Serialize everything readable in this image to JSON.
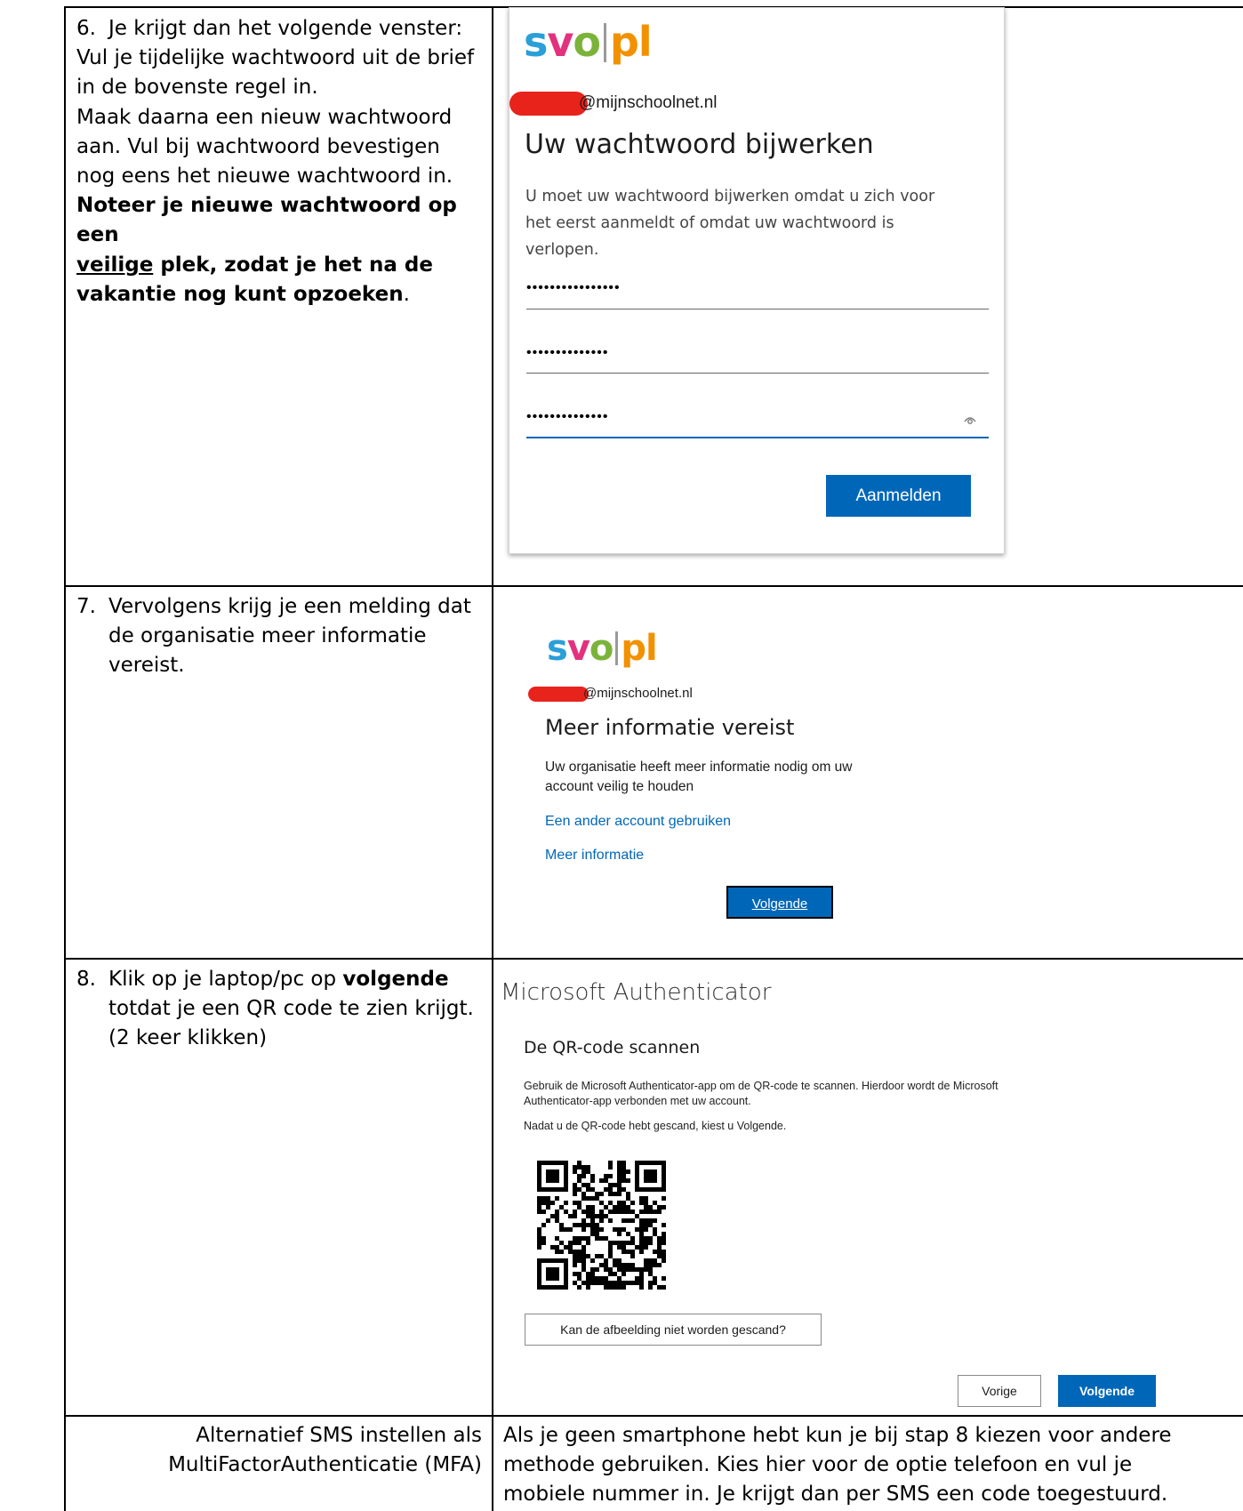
{
  "rows": {
    "step6": {
      "number": "6.",
      "lines": [
        "Je krijgt dan het volgende venster:",
        "Vul je tijdelijke wachtwoord uit de brief",
        "in de bovenste regel in.",
        "Maak daarna een nieuw wachtwoord",
        "aan. Vul bij wachtwoord bevestigen",
        "nog eens het nieuwe wachtwoord in."
      ],
      "bold_1": "Noteer je nieuwe wachtwoord op een",
      "bold_2_underlined": "veilige",
      "bold_2_rest": " plek, zodat je het na de",
      "bold_3": "vakantie nog kunt opzoeken",
      "bold_3_tail": "."
    },
    "step7": {
      "number": "7.",
      "lines": [
        "Vervolgens krijg je een melding dat",
        "de organisatie meer informatie",
        "vereist."
      ]
    },
    "step8": {
      "number": "8.",
      "line1_prefix": "Klik op je laptop/pc op ",
      "line1_bold": "volgende",
      "line2": "totdat je een QR code te zien krijgt.",
      "line3": "(2 keer klikken)"
    },
    "sms": {
      "left_line1": "Alternatief SMS instellen als",
      "left_line2": "MultiFactorAuthenticatie (MFA)",
      "right_lines": [
        "Als je geen smartphone hebt kun je bij stap 8 kiezen voor andere",
        "methode gebruiken. Kies hier voor de optie telefoon en vul je",
        "mobiele nummer in. Je krijgt dan per SMS een code toegestuurd."
      ]
    }
  },
  "logo": {
    "s": "s",
    "v": "v",
    "o": "o",
    "pl": "pl"
  },
  "screen1": {
    "email_domain": "@mijnschoolnet.nl",
    "title": "Uw wachtwoord bijwerken",
    "description": [
      "U moet uw wachtwoord bijwerken omdat u zich voor",
      "het eerst aanmeldt of omdat uw wachtwoord is",
      "verlopen."
    ],
    "password_current": "••••••••••••••••",
    "password_new": "••••••••••••••",
    "password_confirm": "••••••••••••••",
    "submit_label": "Aanmelden"
  },
  "screen2": {
    "email_domain": "@mijnschoolnet.nl",
    "title": "Meer informatie vereist",
    "description": [
      "Uw organisatie heeft meer informatie nodig om uw",
      "account veilig te houden"
    ],
    "link_other_account": "Een ander account gebruiken",
    "link_more_info": "Meer informatie",
    "next_label": "Volgende"
  },
  "screen3": {
    "app_title": "Microsoft Authenticator",
    "heading": "De QR-code scannen",
    "description": [
      "Gebruik de Microsoft Authenticator-app om de QR-code te scannen. Hierdoor wordt de Microsoft",
      "Authenticator-app verbonden met uw account."
    ],
    "instruction": "Nadat u de QR-code hebt gescand, kiest u Volgende.",
    "cant_scan_label": "Kan de afbeelding niet worden gescand?",
    "back_label": "Vorige",
    "next_label": "Volgende"
  },
  "colors": {
    "ms_blue": "#0067b8",
    "logo_s": "#2a9fd8",
    "logo_v": "#e2327e",
    "logo_o": "#7bb33a",
    "logo_pl": "#f29100",
    "redaction": "#e8231c"
  }
}
